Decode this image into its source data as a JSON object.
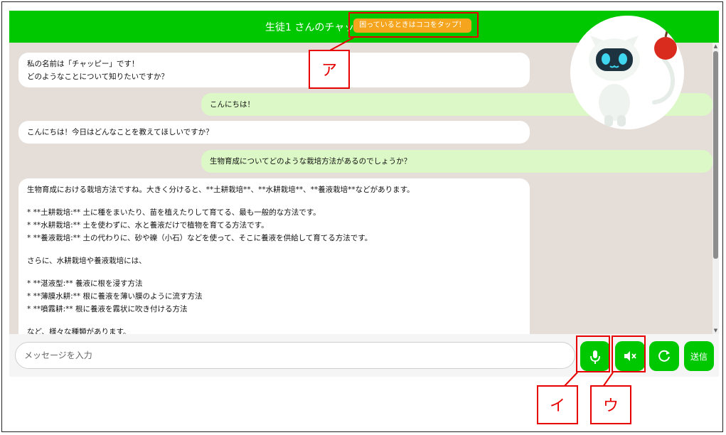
{
  "header": {
    "title": "生徒1 さんのチャット",
    "help_button": "困っているときはココをタップ！"
  },
  "messages": [
    {
      "role": "bot",
      "lines": [
        "私の名前は「チャッピー」です！",
        "どのようなことについて知りたいですか？"
      ]
    },
    {
      "role": "user",
      "lines": [
        "こんにちは！"
      ]
    },
    {
      "role": "bot",
      "lines": [
        "こんにちは！今日はどんなことを教えてほしいですか？"
      ]
    },
    {
      "role": "user",
      "lines": [
        "生物育成についてどのような栽培方法があるのでしょうか？"
      ]
    },
    {
      "role": "bot",
      "lines": [
        "生物育成における栽培方法ですね。大きく分けると、**土耕栽培**、**水耕栽培**、**養液栽培**などがあります。",
        "",
        "* **土耕栽培:** 土に種をまいたり、苗を植えたりして育てる、最も一般的な方法です。",
        "* **水耕栽培:** 土を使わずに、水と養液だけで植物を育てる方法です。",
        "* **養液栽培:** 土の代わりに、砂や礫（小石）などを使って、そこに養液を供給して育てる方法です。",
        "",
        "さらに、水耕栽培や養液栽培には、",
        "",
        "* **湛液型:** 養液に根を浸す方法",
        "* **薄膜水耕:** 根に養液を薄い膜のように流す方法",
        "* **噴霧耕:** 根に養液を霧状に吹き付ける方法",
        "",
        "など、様々な種類があります。"
      ]
    }
  ],
  "input": {
    "placeholder": "メッセージを入力"
  },
  "buttons": {
    "send": "送信"
  },
  "icons": {
    "mic": "microphone-icon",
    "mute": "speaker-mute-icon",
    "reload": "reload-icon"
  },
  "annotations": {
    "a": "ア",
    "i": "イ",
    "u": "ウ"
  },
  "colors": {
    "accent": "#00c800",
    "help": "#f5a41d",
    "bot_bubble": "#ffffff",
    "user_bubble": "#dcf8c6",
    "chat_bg": "#e5ddd8",
    "annotation": "#e60000"
  }
}
